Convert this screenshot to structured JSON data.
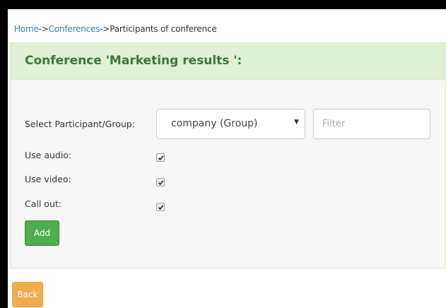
{
  "breadcrumb": {
    "home": "Home",
    "conferences": "Conferences",
    "current": "Participants of conference",
    "separator": "->"
  },
  "panel": {
    "title": "Conference 'Marketing results ':"
  },
  "form": {
    "participant_label": "Select Participant/Group:",
    "participant_selected": "company (Group)",
    "filter_placeholder": "Filter",
    "use_audio_label": "Use audio:",
    "use_audio_checked": true,
    "use_video_label": "Use video:",
    "use_video_checked": true,
    "call_out_label": "Call out:",
    "call_out_checked": true,
    "add_label": "Add"
  },
  "back_label": "Back",
  "colors": {
    "panel_heading_bg": "#dff0d8",
    "panel_title": "#3c763d",
    "link": "#3a7ab8",
    "add_button": "#4cae4c",
    "back_button": "#f0ad4e"
  }
}
